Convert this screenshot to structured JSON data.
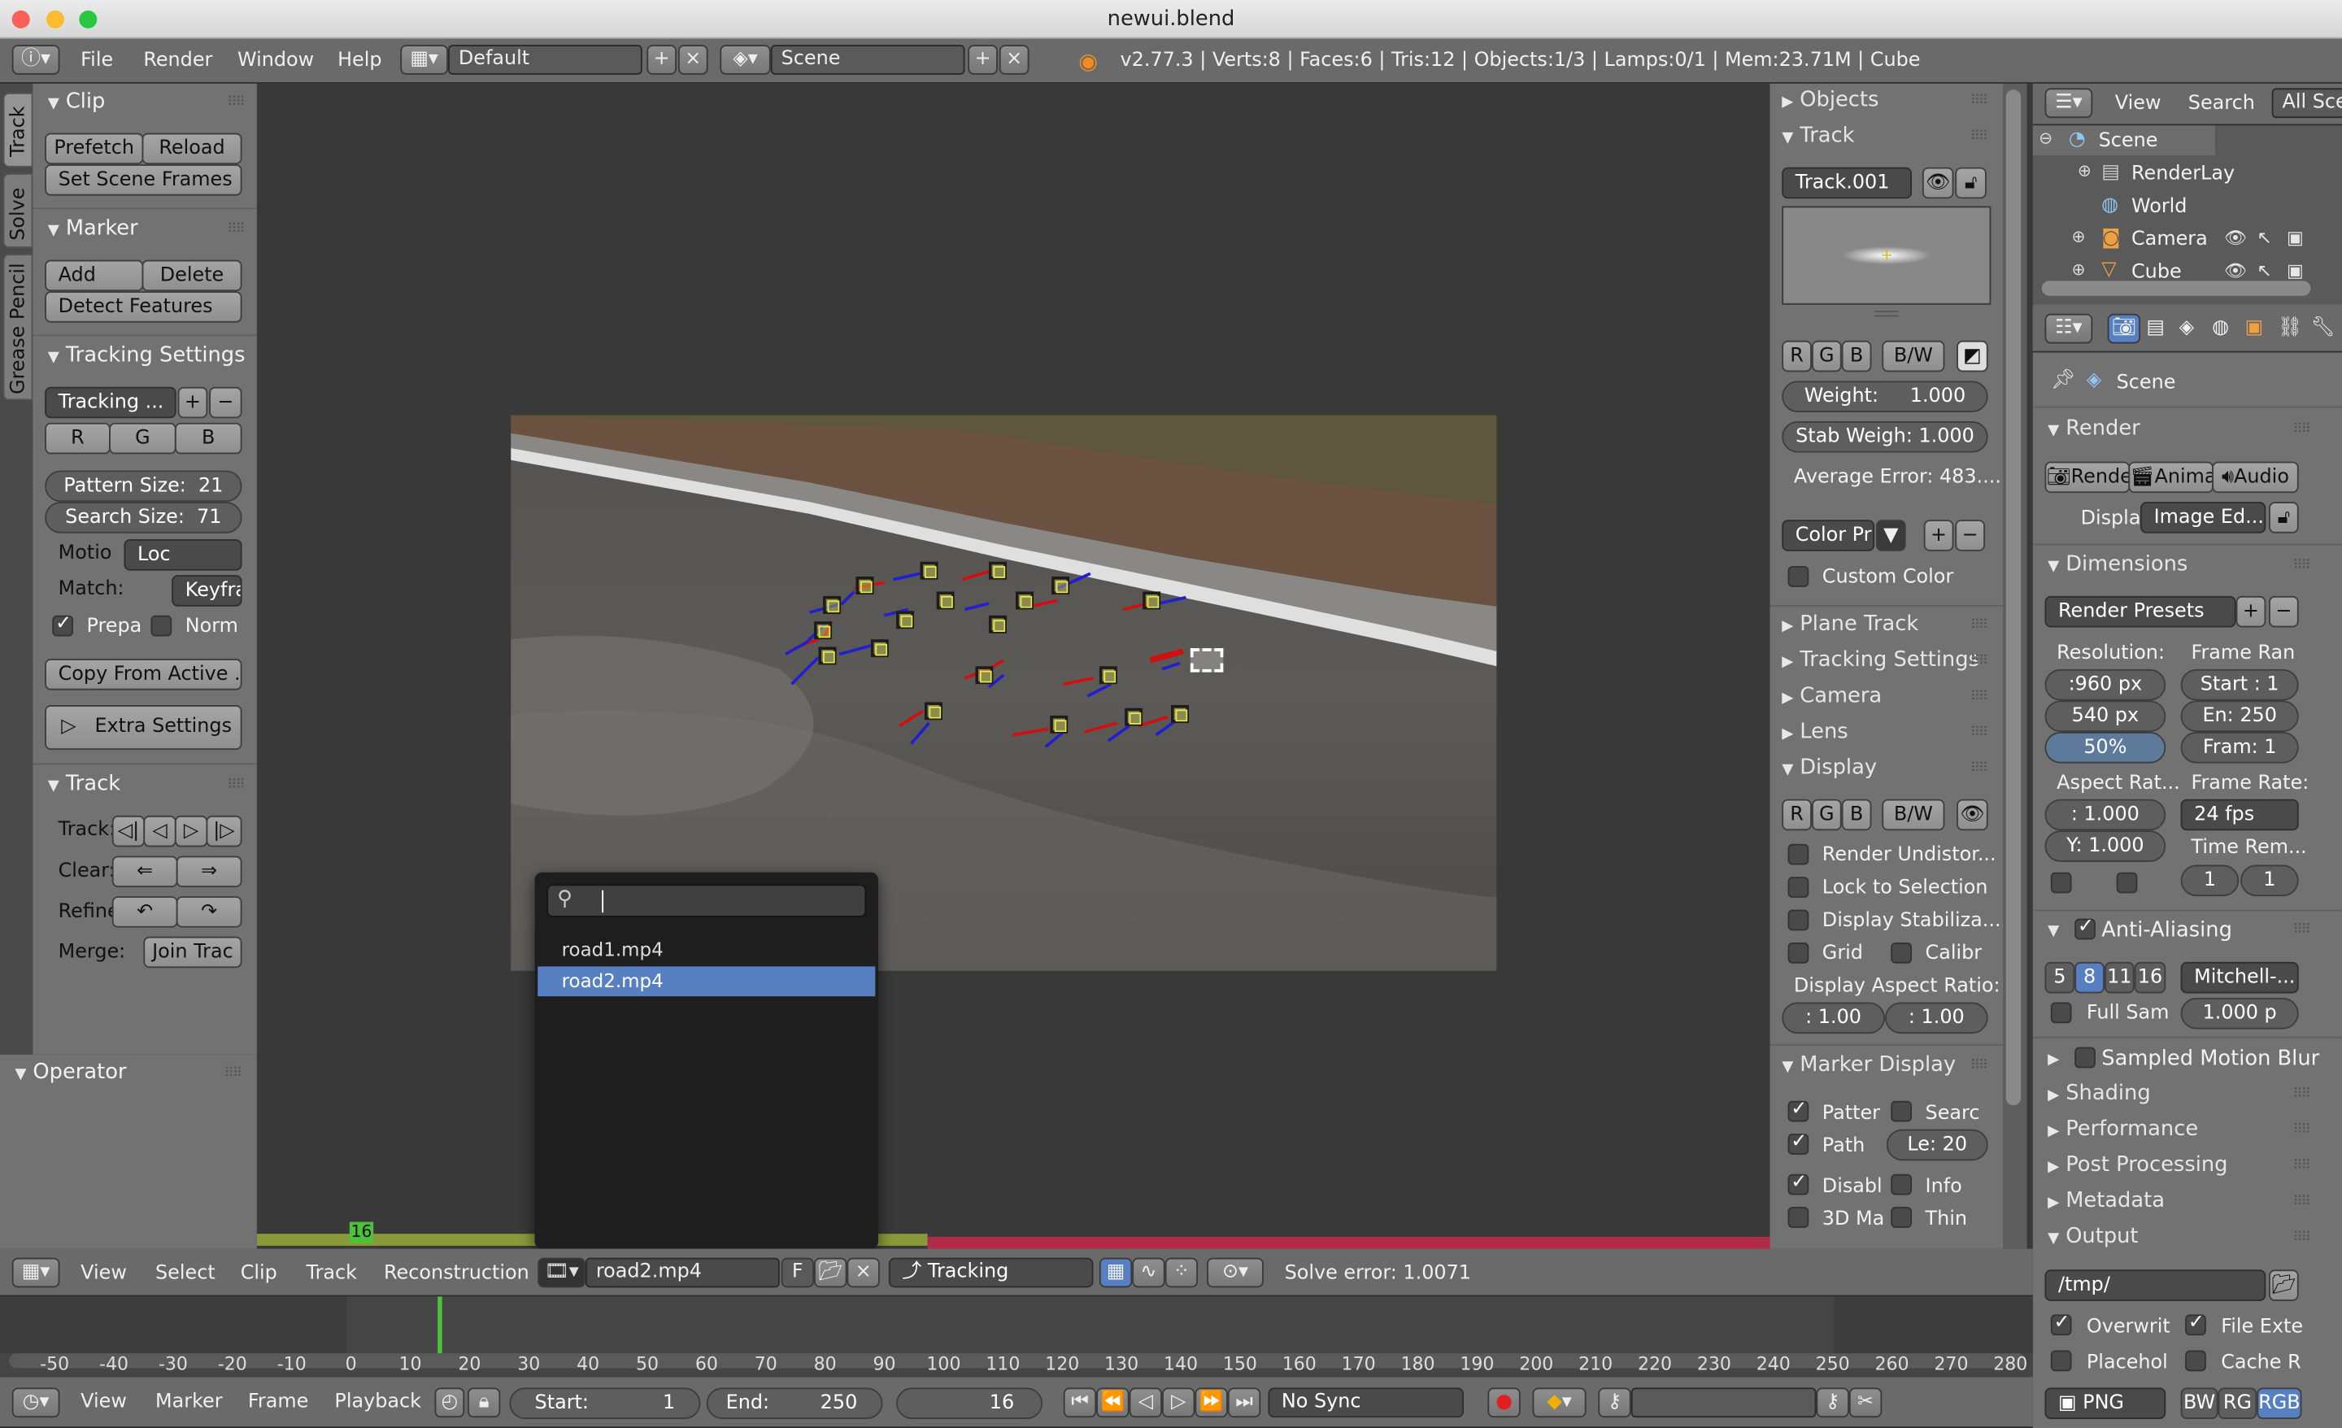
{
  "app": {
    "title": "newui.blend"
  },
  "topbar": {
    "menus": [
      "File",
      "Render",
      "Window",
      "Help"
    ],
    "layout": "Default",
    "scene": "Scene",
    "stats": "v2.77.3 | Verts:8 | Faces:6 | Tris:12 | Objects:1/3 | Lamps:0/1 | Mem:23.71M | Cube"
  },
  "vtabs": [
    "Track",
    "Solve",
    "Grease Pencil"
  ],
  "left": {
    "clip": {
      "title": "Clip",
      "prefetch": "Prefetch",
      "reload": "Reload",
      "set_scene_frames": "Set Scene Frames"
    },
    "marker": {
      "title": "Marker",
      "add": "Add",
      "delete": "Delete",
      "detect": "Detect Features"
    },
    "tracking_settings": {
      "title": "Tracking Settings",
      "preset": "Tracking ...",
      "r": "R",
      "g": "G",
      "b": "B",
      "pattern_size": "Pattern Size:",
      "pattern_val": "21",
      "search_size": "Search Size:",
      "search_val": "71",
      "motion_label": "Motio",
      "motion_val": "Loc",
      "match_label": "Match:",
      "match_val": "Keyfra",
      "prepass": "Prepa",
      "normalize": "Norm",
      "copy_from_active": "Copy From Active ...",
      "extra": "Extra Settings"
    },
    "track": {
      "title": "Track",
      "track_label": "Track:",
      "clear_label": "Clear:",
      "refine_label": "Refine",
      "merge_label": "Merge:",
      "join": "Join Trac"
    },
    "operator": {
      "title": "Operator"
    }
  },
  "dropdown": {
    "items": [
      "road1.mp4",
      "road2.mp4"
    ],
    "selected": "road2.mp4"
  },
  "clip_header": {
    "menus": [
      "View",
      "Select",
      "Clip",
      "Track",
      "Reconstruction"
    ],
    "clip": "road2.mp4",
    "f": "F",
    "mode": "Tracking",
    "solve_error": "Solve error: 1.0071"
  },
  "props": {
    "objects": "Objects",
    "track": {
      "title": "Track",
      "name": "Track.001",
      "r": "R",
      "g": "G",
      "b": "B",
      "bw": "B/W",
      "weight": "Weight:",
      "weight_val": "1.000",
      "stab": "Stab Weigh: 1.000",
      "avg_error": "Average Error: 483....",
      "color_preset": "Color Pr",
      "custom_color": "Custom Color"
    },
    "collapsed": [
      "Plane Track",
      "Tracking Settings",
      "Camera",
      "Lens"
    ],
    "display": {
      "title": "Display",
      "r": "R",
      "g": "G",
      "b": "B",
      "bw": "B/W",
      "render_undistort": "Render Undistor...",
      "lock_selection": "Lock to Selection",
      "display_stab": "Display Stabiliza...",
      "grid": "Grid",
      "calib": "Calibr",
      "aspect_label": "Display Aspect Ratio:",
      "aspect_x": ": 1.00",
      "aspect_y": ": 1.00"
    },
    "marker_display": {
      "title": "Marker Display",
      "pattern": "Patter",
      "search": "Searc",
      "path": "Path",
      "length": "Le: 20",
      "disable": "Disabl",
      "info": "Info",
      "3d": "3D Ma",
      "thin": "Thin"
    }
  },
  "outliner": {
    "view": "View",
    "search": "Search",
    "all": "All Sce",
    "items": [
      "Scene",
      "RenderLay",
      "World",
      "Camera",
      "Cube"
    ]
  },
  "render": {
    "scene": "Scene",
    "render_title": "Render",
    "render_btn": "Rende",
    "anim_btn": "Anima",
    "audio_btn": "Audio",
    "display_label": "Display:",
    "display_val": "Image Ed...",
    "dimensions": "Dimensions",
    "presets": "Render Presets",
    "resolution": "Resolution:",
    "frame_range": "Frame Ran",
    "res_x": ":960 px",
    "res_y": "540 px",
    "res_pct": "50%",
    "start": "Start : 1",
    "end": "En: 250",
    "frame": "Fram: 1",
    "aspect": "Aspect Rat...",
    "frame_rate": "Frame Rate:",
    "asp_x": ": 1.000",
    "asp_y": "Y: 1.000",
    "fps": "24 fps",
    "time_remap": "Time Rem...",
    "tr_old": "1",
    "tr_new": "1",
    "aa_title": "Anti-Aliasing",
    "aa_samples": [
      "5",
      "8",
      "11",
      "16"
    ],
    "aa_filter": "Mitchell-...",
    "full_sample": "Full Sam",
    "filter_size": "1.000 p",
    "motion_blur": "Sampled Motion Blur",
    "shading": "Shading",
    "performance": "Performance",
    "post": "Post Processing",
    "metadata": "Metadata",
    "output": "Output",
    "path": "/tmp/",
    "overwrite": "Overwrit",
    "file_ext": "File Exte",
    "placeholders": "Placehol",
    "cache": "Cache R",
    "format": "PNG",
    "bw": "BW",
    "rg": "RG",
    "rgb": "RGB"
  },
  "timeline": {
    "current_frame_badge": "16",
    "ticks": [
      "-50",
      "-40",
      "-30",
      "-20",
      "-10",
      "0",
      "10",
      "20",
      "30",
      "40",
      "50",
      "60",
      "70",
      "80",
      "90",
      "100",
      "110",
      "120",
      "130",
      "140",
      "150",
      "160",
      "170",
      "180",
      "190",
      "200",
      "210",
      "220",
      "230",
      "240",
      "250",
      "260",
      "270",
      "280"
    ],
    "menus": [
      "View",
      "Marker",
      "Frame",
      "Playback"
    ],
    "start": "Start:",
    "start_val": "1",
    "end": "End:",
    "end_val": "250",
    "frame": "16",
    "sync": "No Sync"
  },
  "colors": {
    "accent": "#5680c2",
    "path_red": "#e01010",
    "path_blue": "#2020d0",
    "marker_yellow": "#e6e650",
    "scrub_green": "#4cc13a",
    "range_red": "#b12a47"
  }
}
